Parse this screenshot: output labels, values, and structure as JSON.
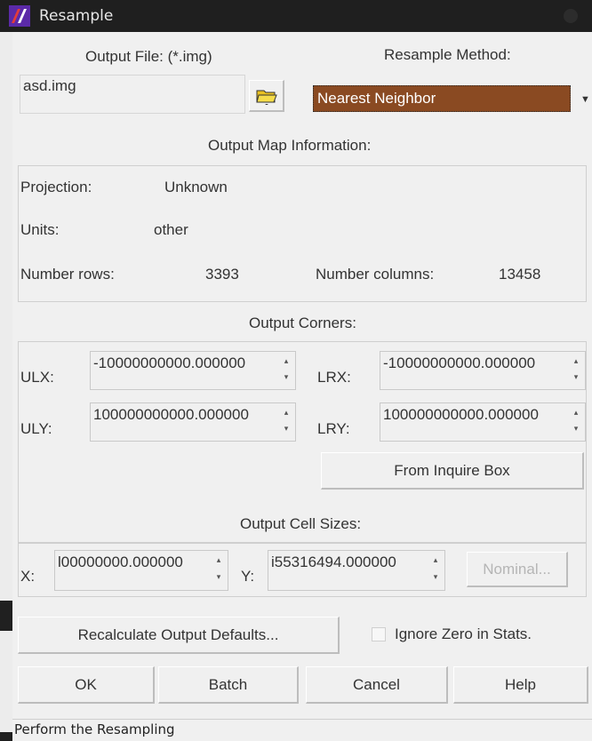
{
  "window": {
    "title": "Resample"
  },
  "output_file": {
    "label": "Output File: (*.img)",
    "value": "asd.img",
    "browse_icon": "folder-open-icon"
  },
  "resample_method": {
    "label": "Resample Method:",
    "selected": "Nearest Neighbor"
  },
  "map_info": {
    "heading": "Output Map Information:",
    "projection_label": "Projection:",
    "projection_value": "Unknown",
    "units_label": "Units:",
    "units_value": "other",
    "rows_label": "Number rows:",
    "rows_value": "3393",
    "cols_label": "Number columns:",
    "cols_value": "13458"
  },
  "corners": {
    "heading": "Output Corners:",
    "ulx_label": "ULX:",
    "ulx_value": "-10000000000.000000",
    "uly_label": "ULY:",
    "uly_value": "100000000000.000000",
    "lrx_label": "LRX:",
    "lrx_value": "-10000000000.000000",
    "lry_label": "LRY:",
    "lry_value": "100000000000.000000",
    "inquire_button": "From Inquire Box"
  },
  "cell_sizes": {
    "heading": "Output Cell Sizes:",
    "x_label": "X:",
    "x_value": "l00000000.000000",
    "y_label": "Y:",
    "y_value": "i55316494.000000",
    "nominal_button": "Nominal..."
  },
  "options": {
    "recalc_button": "Recalculate Output Defaults...",
    "ignore_zero_label": "Ignore Zero in Stats."
  },
  "buttons": {
    "ok": "OK",
    "batch": "Batch",
    "cancel": "Cancel",
    "help": "Help"
  },
  "status_bar": {
    "text": "Perform the Resampling"
  },
  "colors": {
    "accent_selection": "#8a4a22",
    "dialog_bg": "#f0f0f0"
  }
}
